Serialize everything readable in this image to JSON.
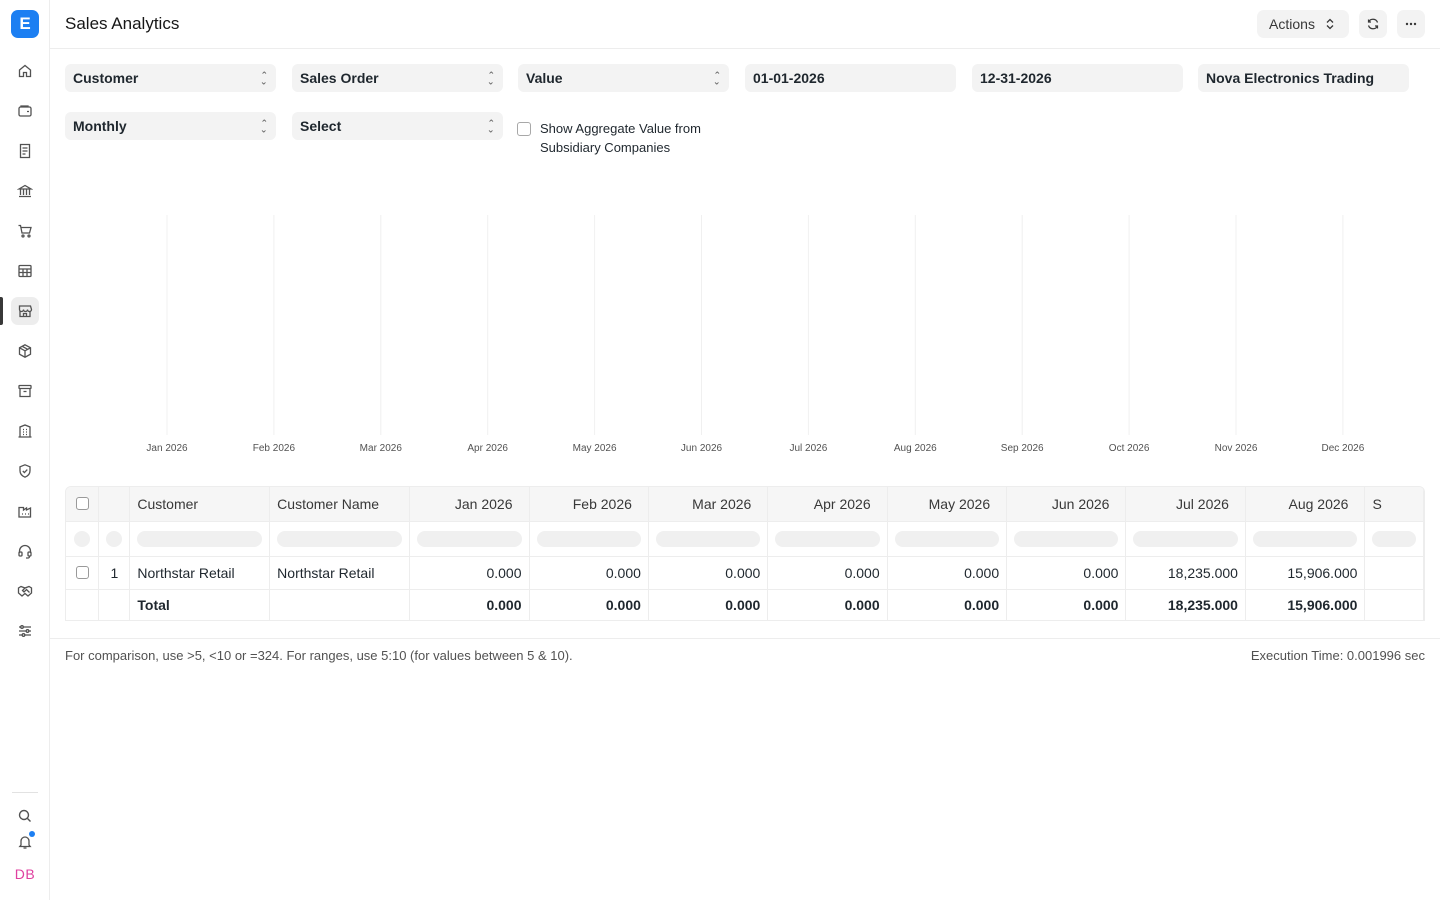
{
  "app": {
    "logo_letter": "E"
  },
  "header": {
    "title": "Sales Analytics",
    "actions_label": "Actions"
  },
  "filters": {
    "tree_type": "Customer",
    "doc_type": "Sales Order",
    "value_quantity": "Value",
    "from_date": "01-01-2026",
    "to_date": "12-31-2026",
    "company": "Nova Electronics Trading",
    "range": "Monthly",
    "curves": "Select",
    "aggregate_label": "Show Aggregate Value from Subsidiary Companies",
    "aggregate_checked": false
  },
  "sidebar": {
    "items": [
      {
        "icon": "home-icon"
      },
      {
        "icon": "wallet-icon"
      },
      {
        "icon": "invoice-icon"
      },
      {
        "icon": "bank-icon"
      },
      {
        "icon": "cart-icon"
      },
      {
        "icon": "table-icon"
      },
      {
        "icon": "store-icon",
        "active": true
      },
      {
        "icon": "package-icon"
      },
      {
        "icon": "archive-icon"
      },
      {
        "icon": "building-icon"
      },
      {
        "icon": "shield-icon"
      },
      {
        "icon": "factory-icon"
      },
      {
        "icon": "headset-icon"
      },
      {
        "icon": "handshake-icon"
      },
      {
        "icon": "sliders-icon"
      }
    ],
    "user_initials": "DB"
  },
  "chart_data": {
    "type": "line",
    "categories": [
      "Jan 2026",
      "Feb 2026",
      "Mar 2026",
      "Apr 2026",
      "May 2026",
      "Jun 2026",
      "Jul 2026",
      "Aug 2026",
      "Sep 2026",
      "Oct 2026",
      "Nov 2026",
      "Dec 2026"
    ],
    "series": [],
    "title": "",
    "xlabel": "",
    "ylabel": "",
    "grid": true
  },
  "table": {
    "columns": [
      "Customer",
      "Customer Name",
      "Jan 2026",
      "Feb 2026",
      "Mar 2026",
      "Apr 2026",
      "May 2026",
      "Jun 2026",
      "Jul 2026",
      "Aug 2026",
      "S"
    ],
    "rows": [
      {
        "index": "1",
        "customer": "Northstar Retail",
        "customer_name": "Northstar Retail",
        "values": [
          "0.000",
          "0.000",
          "0.000",
          "0.000",
          "0.000",
          "0.000",
          "18,235.000",
          "15,906.000"
        ]
      }
    ],
    "total": {
      "label": "Total",
      "values": [
        "0.000",
        "0.000",
        "0.000",
        "0.000",
        "0.000",
        "0.000",
        "18,235.000",
        "15,906.000"
      ]
    }
  },
  "footer": {
    "hint": "For comparison, use >5, <10 or =324. For ranges, use 5:10 (for values between 5 & 10).",
    "execution_time": "Execution Time: 0.001996 sec"
  }
}
